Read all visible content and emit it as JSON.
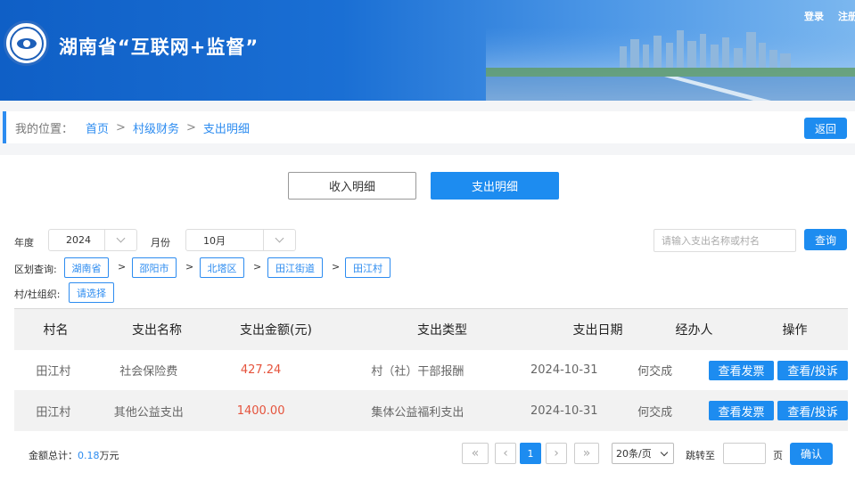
{
  "header": {
    "title": "湖南省“互联网+监督”",
    "login": "登录",
    "register": "注册"
  },
  "breadcrumb": {
    "label": "我的位置：",
    "items": [
      "首页",
      "村级财务",
      "支出明细"
    ],
    "separator": ">",
    "back": "返回"
  },
  "tabs": [
    {
      "label": "收入明细",
      "active": false
    },
    {
      "label": "支出明细",
      "active": true
    }
  ],
  "filters": {
    "year_label": "年度",
    "year_value": "2024",
    "month_label": "月份",
    "month_value": "10月",
    "search_placeholder": "请输入支出名称或村名",
    "query": "查询",
    "region_label": "区划查询:",
    "regions": [
      "湖南省",
      "邵阳市",
      "北塔区",
      "田江街道",
      "田江村"
    ],
    "org_label": "村/社组织:",
    "org_select": "请选择"
  },
  "table": {
    "headers": [
      "村名",
      "支出名称",
      "支出金额(元)",
      "支出类型",
      "支出日期",
      "经办人",
      "操作"
    ],
    "rows": [
      {
        "village": "田江村",
        "name": "社会保险费",
        "amount": "427.24",
        "type": "村（社）干部报酬",
        "date": "2024-10-31",
        "handler": "何交成"
      },
      {
        "village": "田江村",
        "name": "其他公益支出",
        "amount": "1400.00",
        "type": "集体公益福利支出",
        "date": "2024-10-31",
        "handler": "何交成"
      }
    ],
    "op_invoice": "查看发票",
    "op_view": "查看/投诉"
  },
  "footer": {
    "total_label": "金额总计：",
    "total_value": "0.18",
    "total_unit": "万元",
    "current_page": "1",
    "page_size": "20条/页",
    "jump_label": "跳转至",
    "page_word": "页",
    "confirm": "确认"
  },
  "colors": {
    "primary": "#1d8cf0",
    "amount": "#e5533c",
    "header_bg": "#1565c8"
  }
}
